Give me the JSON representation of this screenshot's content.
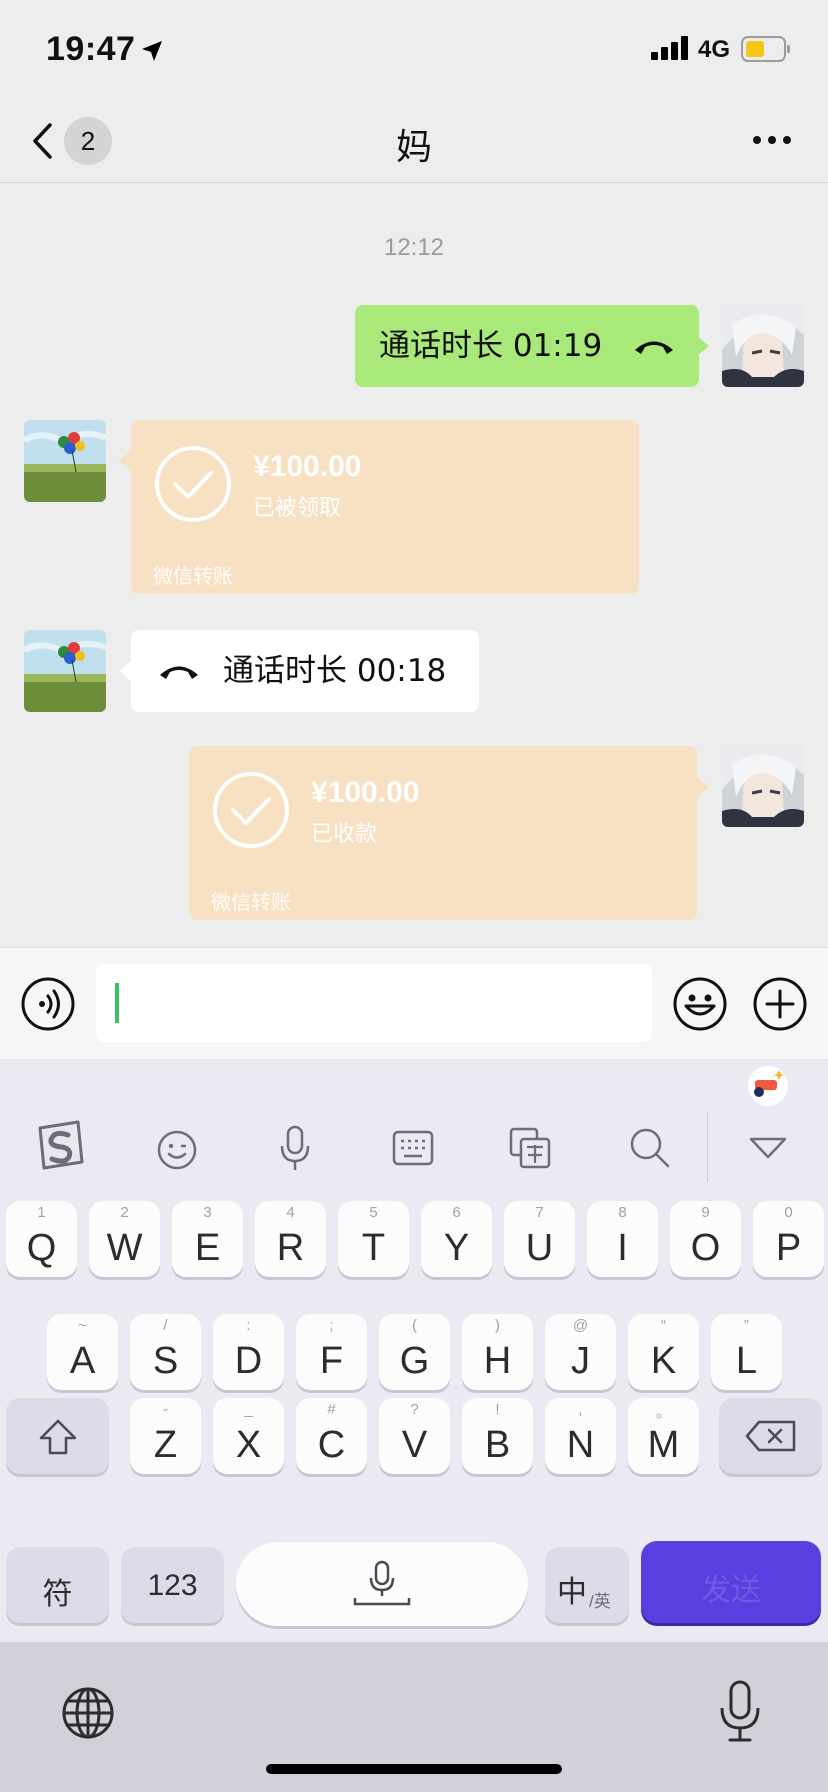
{
  "status_bar": {
    "time": "19:47",
    "network": "4G"
  },
  "nav": {
    "back_count": "2",
    "title": "妈"
  },
  "chat": {
    "timestamp": "12:12",
    "messages": [
      {
        "side": "right",
        "type": "call",
        "text": "通话时长 01:19"
      },
      {
        "side": "left",
        "type": "transfer",
        "amount": "¥100.00",
        "status": "已被领取",
        "brand": "微信转账"
      },
      {
        "side": "left",
        "type": "call",
        "text": "通话时长 00:18"
      },
      {
        "side": "right",
        "type": "transfer",
        "amount": "¥100.00",
        "status": "已收款",
        "brand": "微信转账"
      }
    ]
  },
  "input": {
    "value": ""
  },
  "keyboard": {
    "row1": [
      {
        "k": "Q",
        "h": "1"
      },
      {
        "k": "W",
        "h": "2"
      },
      {
        "k": "E",
        "h": "3"
      },
      {
        "k": "R",
        "h": "4"
      },
      {
        "k": "T",
        "h": "5"
      },
      {
        "k": "Y",
        "h": "6"
      },
      {
        "k": "U",
        "h": "7"
      },
      {
        "k": "I",
        "h": "8"
      },
      {
        "k": "O",
        "h": "9"
      },
      {
        "k": "P",
        "h": "0"
      }
    ],
    "row2": [
      {
        "k": "A",
        "h": "~"
      },
      {
        "k": "S",
        "h": "/"
      },
      {
        "k": "D",
        "h": ":"
      },
      {
        "k": "F",
        "h": ";"
      },
      {
        "k": "G",
        "h": "("
      },
      {
        "k": "H",
        "h": ")"
      },
      {
        "k": "J",
        "h": "@"
      },
      {
        "k": "K",
        "h": "“"
      },
      {
        "k": "L",
        "h": "”"
      }
    ],
    "row3": [
      {
        "k": "Z",
        "h": "-"
      },
      {
        "k": "X",
        "h": "_"
      },
      {
        "k": "C",
        "h": "#"
      },
      {
        "k": "V",
        "h": "?"
      },
      {
        "k": "B",
        "h": "!"
      },
      {
        "k": "N",
        "h": ","
      },
      {
        "k": "M",
        "h": "。"
      }
    ],
    "symbols_key": "符",
    "numbers_key": "123",
    "lang_key_main": "中",
    "lang_key_sub": "/英",
    "send_key": "发送"
  }
}
